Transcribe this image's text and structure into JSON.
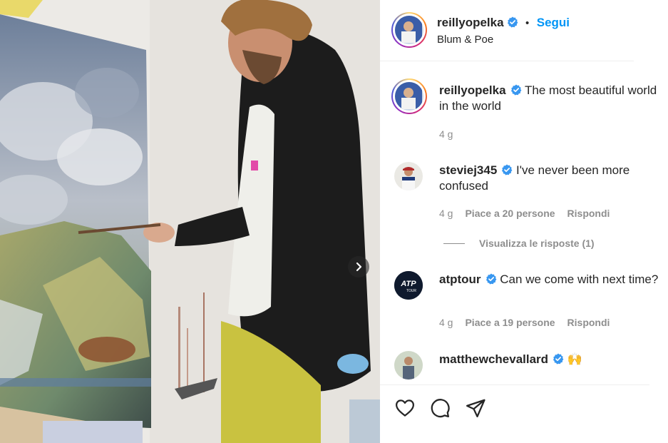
{
  "post": {
    "author": "reillyopelka",
    "follow_label": "Segui",
    "dot": "•",
    "location": "Blum & Poe"
  },
  "comments": [
    {
      "username": "reillyopelka",
      "text": "The most beautiful world in the world",
      "time": "4 g",
      "likes": "",
      "reply": ""
    },
    {
      "username": "steviej345",
      "text": "I've never been more confused",
      "time": "4 g",
      "likes": "Piace a 20 persone",
      "reply": "Rispondi"
    },
    {
      "username": "atptour",
      "text": "Can we come with next time?",
      "time": "4 g",
      "likes": "Piace a 19 persone",
      "reply": "Rispondi"
    },
    {
      "username": "matthewchevallard",
      "text": "🙌",
      "time": "",
      "likes": "",
      "reply": ""
    }
  ],
  "view_replies": "Visualizza le risposte (1)",
  "icons": {
    "verified": "verified-badge-icon",
    "next": "chevron-right-icon",
    "like": "heart-icon",
    "comment": "speech-bubble-icon",
    "share": "paper-plane-icon"
  },
  "colors": {
    "accent": "#0095f6",
    "muted": "#8e8e8e",
    "text": "#262626"
  }
}
